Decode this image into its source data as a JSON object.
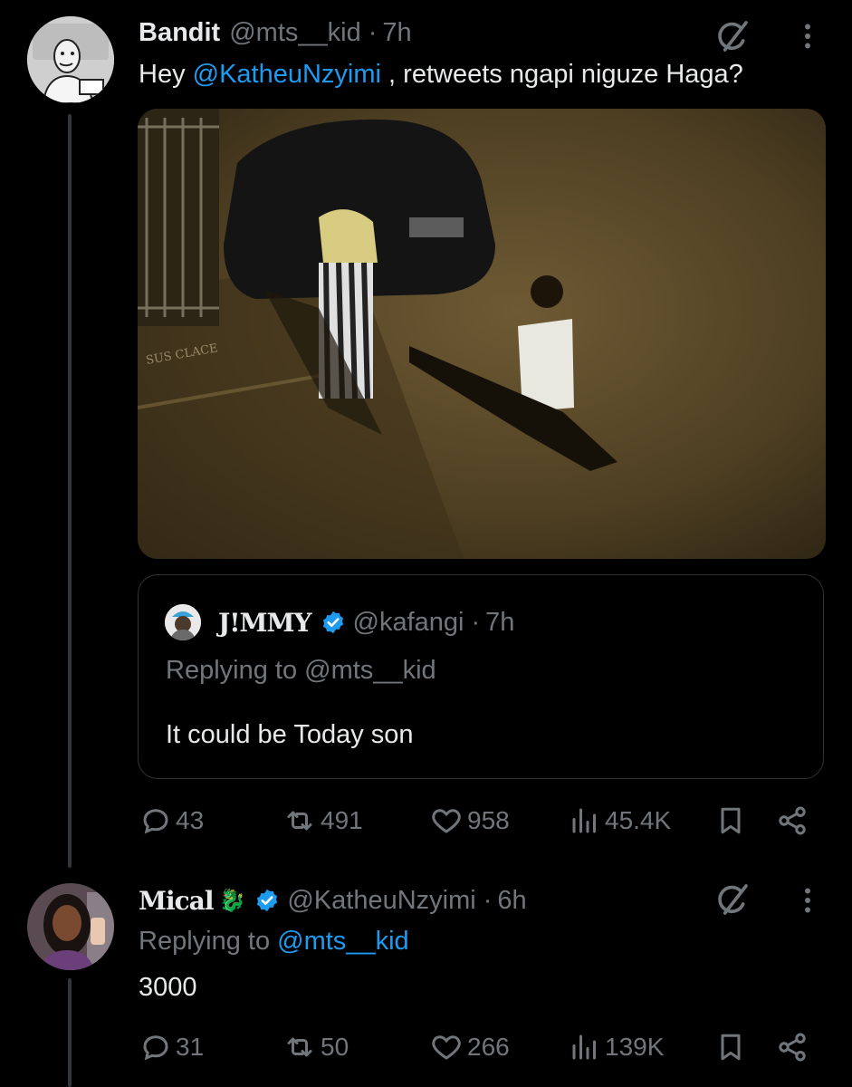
{
  "tweet": {
    "author_name": "Bandit",
    "handle": "@mts__kid",
    "dot": "·",
    "time": "7h",
    "text_prefix": "Hey ",
    "mention": "@KatheuNzyimi",
    "text_suffix": " , retweets ngapi niguze Haga?",
    "media_watermark": "SUS CLACE",
    "quote": {
      "author_name": "J!MMY",
      "handle": "@kafangi",
      "dot": "·",
      "time": "7h",
      "replying_to_prefix": "Replying to ",
      "replying_to_handle": "@mts__kid",
      "text": "It could be Today son"
    },
    "stats": {
      "replies": "43",
      "retweets": "491",
      "likes": "958",
      "views": "45.4K"
    }
  },
  "reply": {
    "author_name": "Mical",
    "author_emoji": "🐉",
    "handle": "@KatheuNzyimi",
    "dot": "·",
    "time": "6h",
    "replying_to_prefix": "Replying to ",
    "replying_to_handle": "@mts__kid",
    "text": "3000",
    "stats": {
      "replies": "31",
      "retweets": "50",
      "likes": "266",
      "views": "139K"
    }
  },
  "colors": {
    "background": "#000000",
    "text": "#e7e9ea",
    "muted": "#71767b",
    "link": "#1d9bf0",
    "verified": "#1d9bf0",
    "thread_line": "#333639"
  },
  "icons": [
    "grok-slash-icon",
    "more-vertical-icon",
    "reply-icon",
    "retweet-icon",
    "like-icon",
    "views-icon",
    "bookmark-icon",
    "share-icon",
    "verified-badge-icon"
  ]
}
